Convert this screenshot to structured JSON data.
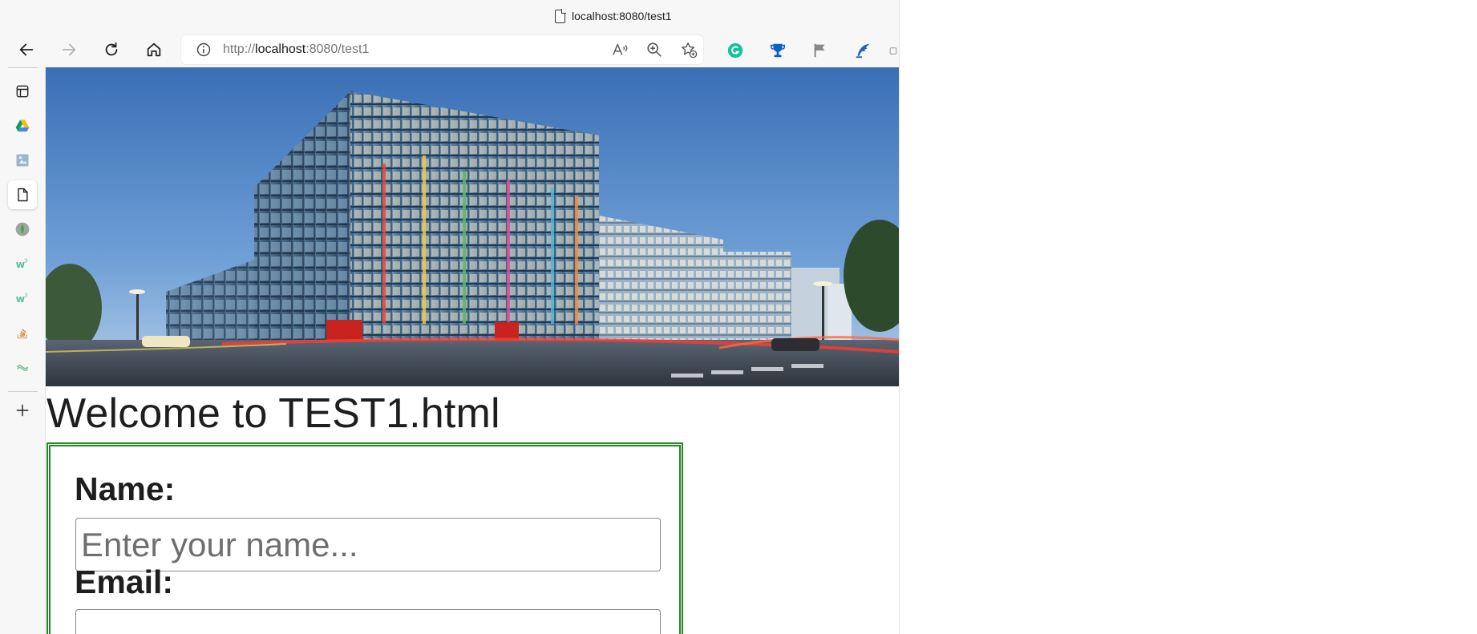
{
  "browser": {
    "tab_title": "localhost:8080/test1",
    "address": {
      "scheme": "http://",
      "host": "localhost",
      "rest": ":8080/test1"
    }
  },
  "page": {
    "heading": "Welcome to TEST1.html",
    "form": {
      "name_label": "Name:",
      "name_placeholder": "Enter your name...",
      "email_label": "Email:"
    }
  },
  "colors": {
    "form_border": "#1f8a1f",
    "grammarly": "#15c39a",
    "accent_blue": "#0b62c4"
  }
}
